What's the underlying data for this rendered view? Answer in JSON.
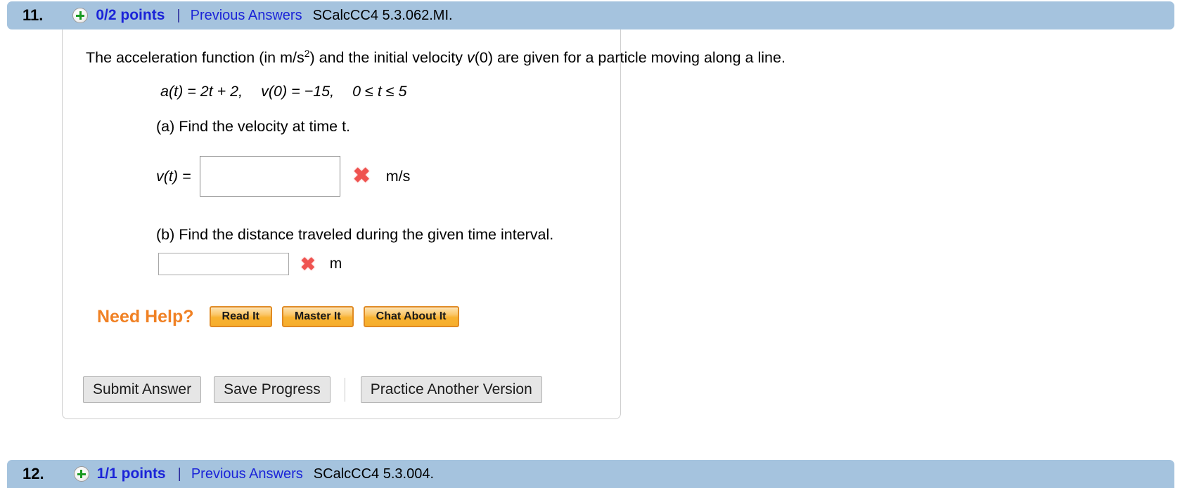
{
  "question_header": {
    "number": "11.",
    "status_icon": "green-plus-icon",
    "points": "0/2 points",
    "separator": "|",
    "previous_answers_link": "Previous Answers",
    "assignment_code": "SCalcCC4 5.3.062.MI."
  },
  "problem": {
    "prompt_part1": "The acceleration function (in m/s",
    "prompt_exponent": "2",
    "prompt_part2": ") and the initial velocity ",
    "prompt_v0": "v",
    "prompt_part3": "(0) are given for a particle moving along a line.",
    "equation": {
      "a_of_t": "a(t) = 2t + 2,",
      "v_initial": "v(0) = −15,",
      "domain": "0 ≤ t ≤ 5"
    },
    "part_a": {
      "label": "(a) Find the velocity at time t.",
      "answer_label": "v(t) =",
      "answer_value": "",
      "answer_placeholder": "",
      "mark_icon": "red-x-incorrect-icon",
      "mark_glyph": "✖",
      "unit": "m/s"
    },
    "part_b": {
      "label": "(b) Find the distance traveled during the given time interval.",
      "answer_value": "",
      "answer_placeholder": "",
      "mark_icon": "red-x-incorrect-icon",
      "mark_glyph": "✖",
      "unit": "m"
    }
  },
  "need_help": {
    "title": "Need Help?",
    "buttons": [
      {
        "label": "Read It",
        "name": "read-it-button"
      },
      {
        "label": "Master It",
        "name": "master-it-button"
      },
      {
        "label": "Chat About It",
        "name": "chat-about-it-button"
      }
    ]
  },
  "actions": {
    "submit": "Submit Answer",
    "save": "Save Progress",
    "practice": "Practice Another Version"
  },
  "next_question_header": {
    "number": "12.",
    "points": "1/1 points",
    "separator": "|",
    "previous_answers_link": "Previous Answers",
    "assignment_code": "SCalcCC4 5.3.004."
  },
  "colors": {
    "header_bar": "#a5c3de",
    "link_blue": "#1b24d8",
    "incorrect_red": "#ef5350",
    "help_orange": "#f08124",
    "help_button_face": "#f8b231",
    "plus_green": "#1a9a22"
  }
}
